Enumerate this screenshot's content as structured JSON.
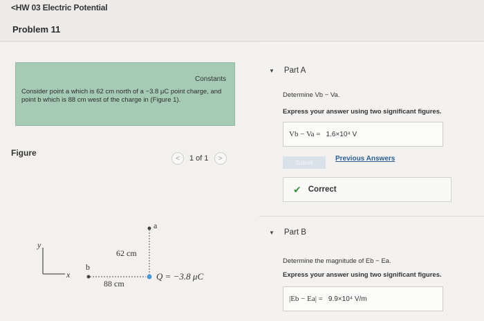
{
  "header": {
    "back_label": "<HW 03 Electric Potential",
    "problem_title": "Problem 11"
  },
  "problem": {
    "constants_label": "Constants",
    "text": "Consider point a which is 62 cm north of a −3.8 μC point charge, and point b which is 88 cm west of the charge in (Figure 1)."
  },
  "figure": {
    "label": "Figure",
    "pager_prev": "<",
    "pager_next": ">",
    "pager_text": "1 of 1",
    "axis_y": "y",
    "axis_x": "x",
    "point_a": "a",
    "point_b": "b",
    "dist_vertical": "62 cm",
    "dist_horizontal": "88 cm",
    "charge_label": "Q = −3.8 μC"
  },
  "partA": {
    "caret": "▼",
    "title": "Part A",
    "prompt": "Determine Vb − Va.",
    "instruction": "Express your answer using two significant figures.",
    "answer_lhs": "Vb − Va =",
    "answer_value": "1.6×10⁴ V",
    "submit_label": "Submit",
    "previous_answers_label": "Previous Answers",
    "correct_label": "Correct",
    "check_icon": "✔"
  },
  "partB": {
    "caret": "▼",
    "title": "Part B",
    "prompt": "Determine the magnitude of Eb − Ea.",
    "instruction": "Express your answer using two significant figures.",
    "answer_lhs": "|Eb − Ea| =",
    "answer_value": "9.9×10⁴ V/m"
  }
}
